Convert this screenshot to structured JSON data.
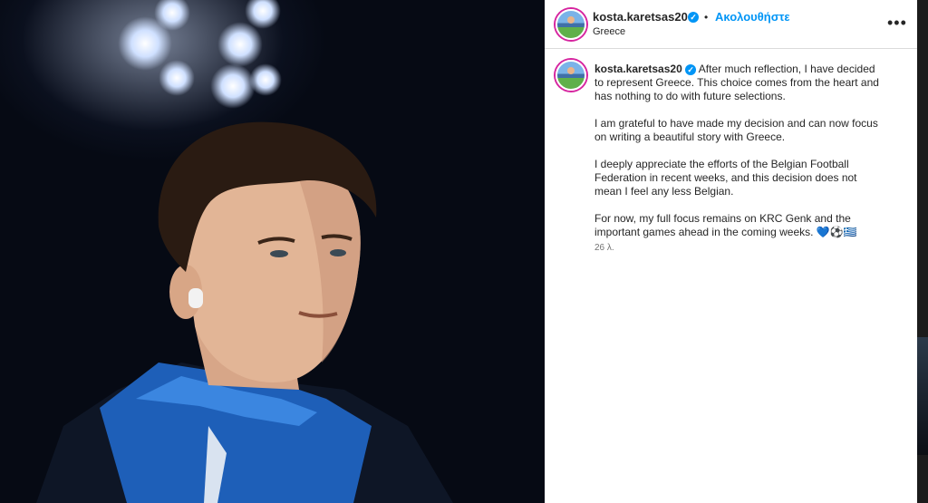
{
  "header": {
    "username": "kosta.karetsas20",
    "separator": "•",
    "follow_label": "Ακολουθήστε",
    "location": "Greece",
    "more_label": "•••"
  },
  "caption": {
    "username": "kosta.karetsas20",
    "paragraph_1": "After much reflection, I have decided to represent Greece. This choice comes from the heart and has nothing to do with future selections.",
    "paragraph_2": "I am grateful to have made my decision and can now focus on writing a beautiful story with Greece.",
    "paragraph_3": "I deeply appreciate the efforts of the Belgian Football Federation in recent weeks, and this decision does not mean I feel any less Belgian.",
    "paragraph_4": "For now, my full focus remains on KRC Genk and the important games ahead in the coming weeks. 💙⚽🇬🇷",
    "timestamp": "26 λ."
  },
  "colors": {
    "accent": "#0095f6",
    "verified": "#0095f6",
    "text": "#262626",
    "muted": "#737373"
  },
  "icons": [
    "verified-badge-icon",
    "more-options-icon"
  ]
}
